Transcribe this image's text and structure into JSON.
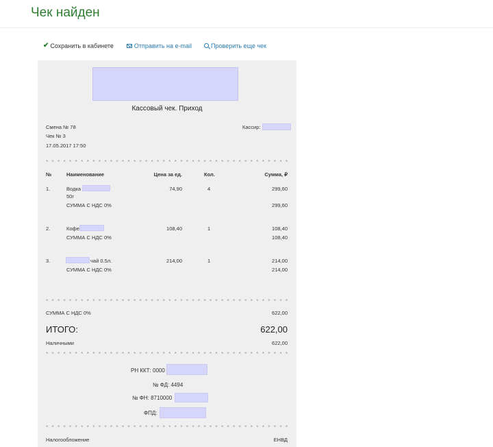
{
  "page": {
    "title": "Чек найден"
  },
  "actions": {
    "save": "Сохранить в кабинете",
    "email": "Отправить на e-mail",
    "check": "Проверить еще чек"
  },
  "receipt": {
    "title": "Кассовый чек. Приход",
    "shift": "Смена № 78",
    "check_no": "Чек № 3",
    "datetime": "17.05.2017 17:50",
    "cashier_label": "Кассир:",
    "columns": {
      "num": "№",
      "name": "Наименование",
      "price": "Цена за ед.",
      "qty": "Кол.",
      "sum": "Сумма, ₽"
    },
    "items": [
      {
        "num": "1.",
        "name": "Водка",
        "name_line2": "50г",
        "price": "74,90",
        "qty": "4",
        "sum": "299,60",
        "vat_label": "СУММА С НДС 0%",
        "vat_sum": "299,60"
      },
      {
        "num": "2.",
        "name": "Кофе",
        "price": "108,40",
        "qty": "1",
        "sum": "108,40",
        "vat_label": "СУММА С НДС 0%",
        "vat_sum": "108,40"
      },
      {
        "num": "3.",
        "name": "чай 0.5л.",
        "price": "214,00",
        "qty": "1",
        "sum": "214,00",
        "vat_label": "СУММА С НДС 0%",
        "vat_sum": "214,00"
      }
    ],
    "vat_total_label": "СУММА С НДС 0%",
    "vat_total": "622,00",
    "total_label": "ИТОГО:",
    "total": "622,00",
    "cash_label": "Наличными",
    "cash": "622,00",
    "rn_kkt": "РН ККТ: 0000",
    "fd": "№ ФД: 4494",
    "fn": "№ ФН: 8710000",
    "fpd": "ФПД:",
    "tax_label": "Налогообложение",
    "tax_value": "ЕНВД",
    "stars": "* * * * * * * * * * * * * * * * * * * * * * * * * * * * * * * * * * * * * * * * * * * * * * * * * * * * * * * * * *"
  }
}
